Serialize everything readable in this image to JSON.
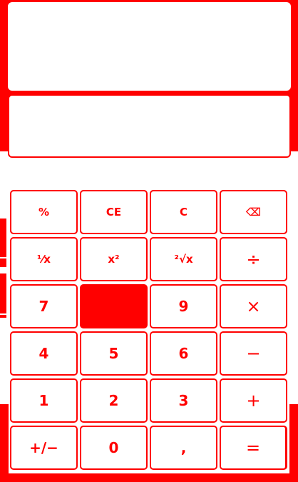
{
  "window": {
    "title": ""
  },
  "display": {
    "value": ""
  },
  "keypad": {
    "rows": [
      [
        {
          "label": "%",
          "name": "percent-button"
        },
        {
          "label": "CE",
          "name": "clear-entry-button"
        },
        {
          "label": "C",
          "name": "clear-button"
        },
        {
          "label": "⌫",
          "name": "backspace-button"
        }
      ],
      [
        {
          "label": "⅟x",
          "name": "reciprocal-button"
        },
        {
          "label": "x²",
          "name": "square-button"
        },
        {
          "label": "²√x",
          "name": "square-root-button"
        },
        {
          "label": "÷",
          "name": "divide-button"
        }
      ],
      [
        {
          "label": "7",
          "name": "digit-7-button"
        },
        {
          "label": "",
          "name": "digit-8-button"
        },
        {
          "label": "9",
          "name": "digit-9-button"
        },
        {
          "label": "×",
          "name": "multiply-button"
        }
      ],
      [
        {
          "label": "4",
          "name": "digit-4-button"
        },
        {
          "label": "5",
          "name": "digit-5-button"
        },
        {
          "label": "6",
          "name": "digit-6-button"
        },
        {
          "label": "−",
          "name": "subtract-button"
        }
      ],
      [
        {
          "label": "1",
          "name": "digit-1-button"
        },
        {
          "label": "2",
          "name": "digit-2-button"
        },
        {
          "label": "3",
          "name": "digit-3-button"
        },
        {
          "label": "+",
          "name": "add-button"
        }
      ],
      [
        {
          "label": "+/−",
          "name": "negate-button"
        },
        {
          "label": "0",
          "name": "digit-0-button"
        },
        {
          "label": ",",
          "name": "decimal-button"
        },
        {
          "label": "=",
          "name": "equals-button"
        }
      ]
    ]
  },
  "colors": {
    "accent": "#ff0000",
    "background": "#ffffff"
  }
}
